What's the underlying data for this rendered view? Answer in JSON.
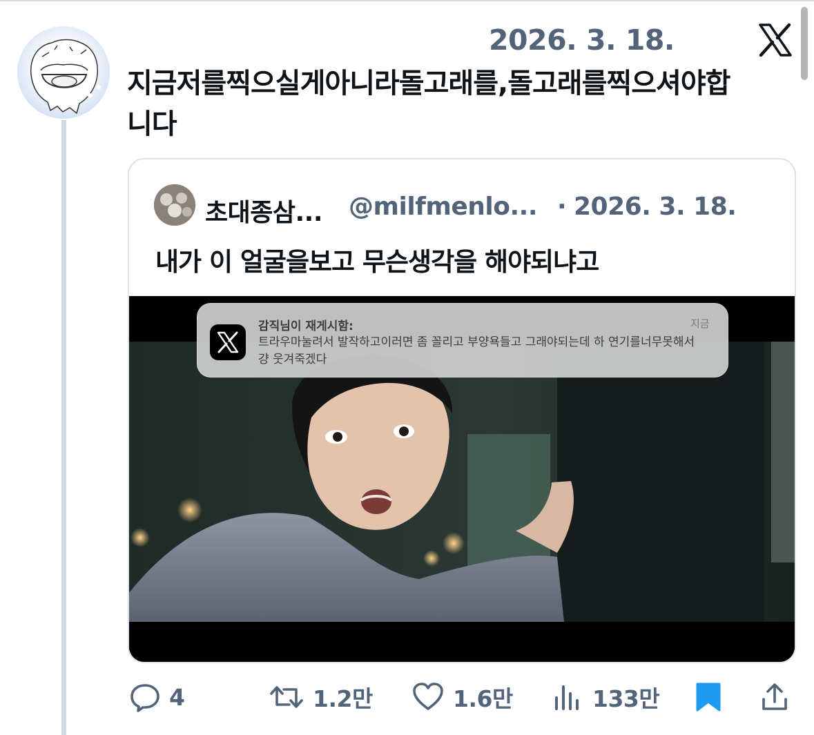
{
  "tweet": {
    "date": "2026. 3. 18.",
    "text_line1": "지금저를찍으실게아니라돌고래를,돌고래를찍으셔야합",
    "text_line2": "니다"
  },
  "quote": {
    "name": "초대종삼...",
    "handle": "@milfmenlo...",
    "separator": "·",
    "date": "2026. 3. 18.",
    "text": "내가 이 얼굴을보고 무슨생각을 해야되냐고"
  },
  "notification": {
    "title": "감직님이 재게시함:",
    "time": "지금",
    "body": "트라우마눌려서 발작하고이러면 좀 꼴리고 부양욕들고 그래야되는데 하 연기를너무못해서 걍 웃겨죽겠다"
  },
  "actions": {
    "replies": "4",
    "reposts": "1.2만",
    "likes": "1.6만",
    "views": "133만"
  },
  "colors": {
    "text": "#0f1419",
    "secondary": "#53647a",
    "accent": "#1d9bf0",
    "border": "#dde3e8"
  },
  "icons": [
    "reply-icon",
    "repost-icon",
    "like-icon",
    "views-icon",
    "bookmark-icon",
    "share-icon",
    "x-logo-icon"
  ]
}
